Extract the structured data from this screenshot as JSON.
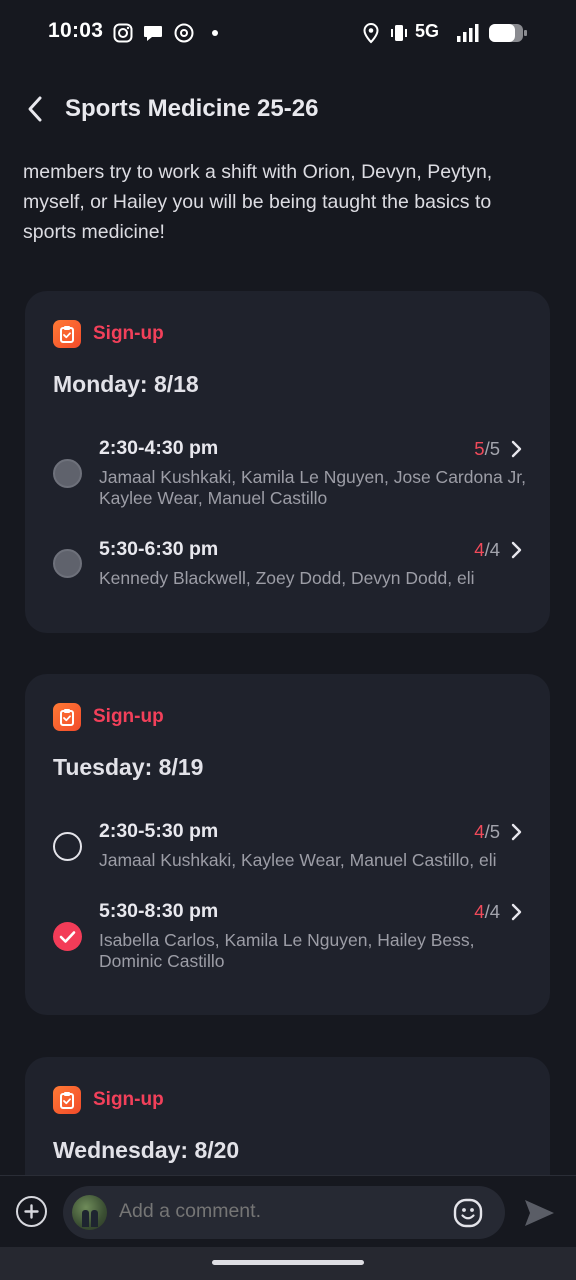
{
  "status": {
    "time": "10:03",
    "network": "5G",
    "icons": [
      "instagram-icon",
      "chat-bubble-icon",
      "threads-icon",
      "location-icon",
      "vibrate-icon",
      "signal-icon",
      "battery-icon"
    ]
  },
  "header": {
    "title": "Sports Medicine 25-26",
    "back_icon": "back-chevron-icon"
  },
  "description": "members try to work a shift with Orion, Devyn, Peytyn, myself, or Hailey you will be being taught the basics to sports medicine!",
  "colors": {
    "accent": "#f33c58",
    "tag_icon": "#f4572e",
    "background": "#16181f",
    "card": "#1f222c"
  },
  "cards": [
    {
      "tag": "Sign-up",
      "title": "Monday: 8/18",
      "slots": [
        {
          "time": "2:30-4:30 pm",
          "filled": "5",
          "capacity": "/5",
          "names": "Jamaal Kushkaki, Kamila Le Nguyen, Jose Cardona Jr, Kaylee Wear, Manuel Castillo",
          "state": "disabled"
        },
        {
          "time": "5:30-6:30 pm",
          "filled": "4",
          "capacity": "/4",
          "names": "Kennedy Blackwell, Zoey Dodd, Devyn Dodd, eli",
          "state": "disabled"
        }
      ]
    },
    {
      "tag": "Sign-up",
      "title": "Tuesday: 8/19",
      "slots": [
        {
          "time": "2:30-5:30 pm",
          "filled": "4",
          "capacity": "/5",
          "names": "Jamaal Kushkaki, Kaylee Wear, Manuel Castillo, eli",
          "state": "empty"
        },
        {
          "time": "5:30-8:30 pm",
          "filled": "4",
          "capacity": "/4",
          "names": "Isabella Carlos, Kamila Le Nguyen, Hailey Bess, Dominic Castillo",
          "state": "checked"
        }
      ]
    },
    {
      "tag": "Sign-up",
      "title": "Wednesday: 8/20"
    }
  ],
  "comment": {
    "placeholder": "Add a comment.",
    "add_icon": "plus-circle-icon",
    "emoji_icon": "emoji-icon",
    "send_icon": "send-icon"
  }
}
